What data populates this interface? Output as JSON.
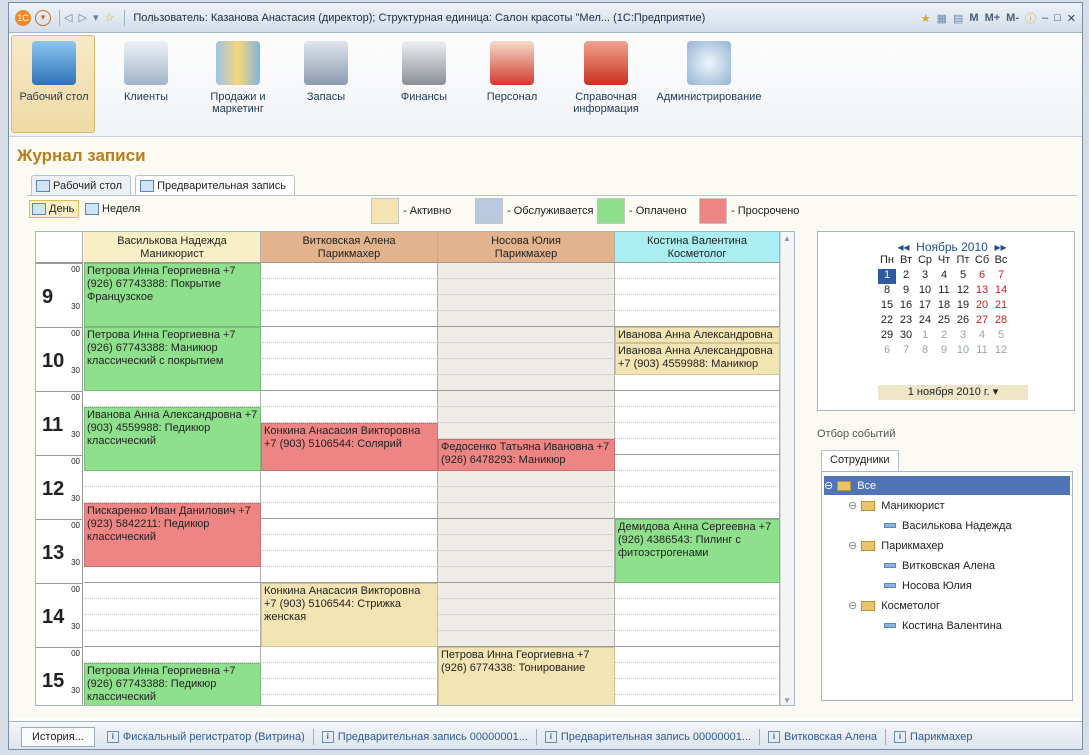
{
  "window": {
    "title": "Пользователь: Казанова Анастасия (директор);  Структурная единица: Салон красоты \"Мел...  (1С:Предприятие)",
    "m_buttons": [
      "M",
      "M+",
      "M-"
    ]
  },
  "ribbon": [
    {
      "label": "Рабочий стол",
      "icon": "desktop-icon"
    },
    {
      "label": "Клиенты",
      "icon": "clients-icon"
    },
    {
      "label": "Продажи и маркетинг",
      "icon": "sales-icon"
    },
    {
      "label": "Запасы",
      "icon": "stock-icon"
    },
    {
      "label": "Финансы",
      "icon": "cash-register-icon"
    },
    {
      "label": "Персонал",
      "icon": "staff-icon"
    },
    {
      "label": "Справочная информация",
      "icon": "reference-book-icon"
    },
    {
      "label": "Администрирование",
      "icon": "admin-icon"
    }
  ],
  "page_title": "Журнал записи",
  "tabs": [
    "Рабочий стол",
    "Предварительная запись"
  ],
  "view": {
    "day": "День",
    "week": "Неделя"
  },
  "legend": [
    {
      "label": "- Активно",
      "color": "#f3e4b3"
    },
    {
      "label": "- Обслуживается",
      "color": "#b9c9de"
    },
    {
      "label": "- Оплачено",
      "color": "#8fe08c"
    },
    {
      "label": "- Просрочено",
      "color": "#ee8585"
    }
  ],
  "columns": [
    {
      "name": "Василькова Надежда",
      "role": "Маникюрист",
      "color": "#f7f0c6"
    },
    {
      "name": "Витковская Алена",
      "role": "Парикмахер",
      "color": "#e2b38c"
    },
    {
      "name": "Носова Юлия",
      "role": "Парикмахер",
      "color": "#e2b38c"
    },
    {
      "name": "Костина Валентина",
      "role": "Косметолог",
      "color": "#aaeef2"
    }
  ],
  "hours": [
    "9",
    "10",
    "11",
    "12",
    "13",
    "14",
    "15"
  ],
  "minutes": [
    "00",
    "30"
  ],
  "appointments": [
    {
      "col": 0,
      "start": 0,
      "slots": 4,
      "status": "paid",
      "text": "Петрова Инна Георгиевна +7 (926) 67743388: Покрытие Французское"
    },
    {
      "col": 0,
      "start": 4,
      "slots": 4,
      "status": "paid",
      "text": "Петрова Инна Георгиевна +7 (926) 67743388: Маникюр классический с покрытием"
    },
    {
      "col": 0,
      "start": 9,
      "slots": 4,
      "status": "paid",
      "text": "Иванова Анна Александровна +7 (903) 4559988: Педикюр классический"
    },
    {
      "col": 0,
      "start": 15,
      "slots": 4,
      "status": "overdue",
      "text": "Пискаренко Иван Данилович +7 (923) 5842211: Педикюр классический"
    },
    {
      "col": 0,
      "start": 25,
      "slots": 3,
      "status": "paid",
      "text": "Петрова Инна Георгиевна +7 (926) 67743388: Педикюр классический"
    },
    {
      "col": 1,
      "start": 10,
      "slots": 3,
      "status": "overdue",
      "text": "Конкина Анасасия Викторовна +7 (903) 5106544: Солярий"
    },
    {
      "col": 1,
      "start": 20,
      "slots": 4,
      "status": "active",
      "text": "Конкина Анасасия Викторовна +7 (903) 5106544: Стрижка женская"
    },
    {
      "col": 2,
      "start": 11,
      "slots": 2,
      "status": "overdue",
      "text": "Федосенко Татьяна Ивановна +7 (926) 6478293: Маникюр"
    },
    {
      "col": 2,
      "start": 24,
      "slots": 4,
      "status": "active",
      "text": "Петрова Инна Георгиевна +7 (926) 6774338: Тонирование"
    },
    {
      "col": 3,
      "start": 4,
      "slots": 1,
      "status": "active",
      "text": "Иванова Анна Александровна"
    },
    {
      "col": 3,
      "start": 5,
      "slots": 2,
      "status": "active",
      "text": "Иванова Анна Александровна +7 (903) 4559988: Маникюр"
    },
    {
      "col": 3,
      "start": 16,
      "slots": 4,
      "status": "paid",
      "text": "Демидова Анна Сергеевна +7 (926) 4386543: Пилинг с фитоэстрогенами"
    }
  ],
  "calendar": {
    "month": "Ноябрь 2010",
    "weekdays": [
      "Пн",
      "Вт",
      "Ср",
      "Чт",
      "Пт",
      "Сб",
      "Вс"
    ],
    "weeks": [
      [
        "1",
        "2",
        "3",
        "4",
        "5",
        "6",
        "7"
      ],
      [
        "8",
        "9",
        "10",
        "11",
        "12",
        "13",
        "14"
      ],
      [
        "15",
        "16",
        "17",
        "18",
        "19",
        "20",
        "21"
      ],
      [
        "22",
        "23",
        "24",
        "25",
        "26",
        "27",
        "28"
      ],
      [
        "29",
        "30",
        "1",
        "2",
        "3",
        "4",
        "5"
      ],
      [
        "6",
        "7",
        "8",
        "9",
        "10",
        "11",
        "12"
      ]
    ],
    "selected": "1",
    "footer": "1 ноября 2010 г."
  },
  "filter": {
    "label": "Отбор событий",
    "tab": "Сотрудники",
    "tree": [
      {
        "level": 0,
        "text": "Все",
        "type": "group",
        "selected": true
      },
      {
        "level": 1,
        "text": "Маникюрист",
        "type": "group"
      },
      {
        "level": 2,
        "text": "Василькова Надежда",
        "type": "item"
      },
      {
        "level": 1,
        "text": "Парикмахер",
        "type": "group"
      },
      {
        "level": 2,
        "text": "Витковская Алена",
        "type": "item"
      },
      {
        "level": 2,
        "text": "Носова Юлия",
        "type": "item"
      },
      {
        "level": 1,
        "text": "Косметолог",
        "type": "group"
      },
      {
        "level": 2,
        "text": "Костина Валентина",
        "type": "item"
      }
    ]
  },
  "statusbar": {
    "history": "История...",
    "items": [
      "Фискальный регистратор (Витрина)",
      "Предварительная запись 00000001...",
      "Предварительная запись 00000001...",
      "Витковская Алена",
      "Парикмахер"
    ]
  }
}
